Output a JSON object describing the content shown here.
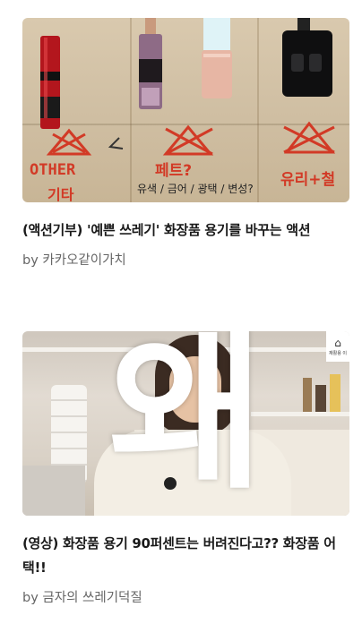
{
  "feed": {
    "cards": [
      {
        "title": "(액션기부) '예쁜 쓰레기' 화장품 용기를 바꾸는 액션",
        "byline": "by 카카오같이가치",
        "thumbnail": {
          "annotations": {
            "other": "OTHER",
            "other_sub": "기타",
            "pet": "페트?",
            "pet_sub": "유색 / 금어 / 광택 / 변성?",
            "glass": "유리+철"
          }
        }
      },
      {
        "title": "(영상) 화장품 용기 90퍼센트는 버려진다고?? 화장품 어택!!",
        "byline": "by 금자의 쓰레기덕질",
        "thumbnail": {
          "overlay_glyph": "왜",
          "logo_text": "재활용 이"
        }
      }
    ]
  },
  "colors": {
    "title": "#1a1a1a",
    "byline": "#666666",
    "annotation_red": "#d23a26"
  }
}
